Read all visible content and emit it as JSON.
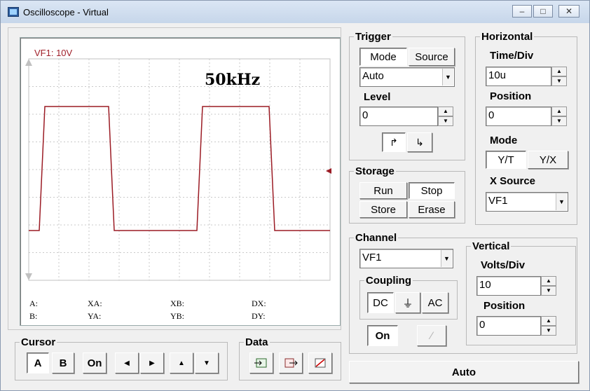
{
  "window": {
    "title": "Oscilloscope - Virtual"
  },
  "screen": {
    "channel_label": "VF1: 10V",
    "frequency": "50kHz",
    "trace_color": "#9b1b24",
    "square_wave": {
      "high_level": 1,
      "low_level": 0,
      "segments": [
        "low",
        "high",
        "low",
        "high",
        "low"
      ]
    },
    "cursor_readouts": {
      "a": "A:",
      "b": "B:",
      "xa": "XA:",
      "ya": "YA:",
      "xb": "XB:",
      "yb": "YB:",
      "dx": "DX:",
      "dy": "DY:"
    }
  },
  "trigger": {
    "title": "Trigger",
    "mode_button": "Mode",
    "source_button": "Source",
    "mode_value": "Auto",
    "level_label": "Level",
    "level_value": "0",
    "falling_edge_icon": "falling-edge-icon",
    "rising_edge_icon": "rising-edge-icon"
  },
  "horizontal": {
    "title": "Horizontal",
    "time_div_label": "Time/Div",
    "time_div_value": "10u",
    "position_label": "Position",
    "position_value": "0",
    "mode_label": "Mode",
    "yt_button": "Y/T",
    "yx_button": "Y/X",
    "x_source_label": "X Source",
    "x_source_value": "VF1"
  },
  "storage": {
    "title": "Storage",
    "run": "Run",
    "stop": "Stop",
    "store": "Store",
    "erase": "Erase"
  },
  "channel": {
    "title": "Channel",
    "channel_value": "VF1",
    "coupling_label": "Coupling",
    "dc": "DC",
    "gnd_icon": "ground-icon",
    "ac": "AC",
    "on_button": "On",
    "probe_icon": "probe-icon"
  },
  "vertical": {
    "title": "Vertical",
    "volts_div_label": "Volts/Div",
    "volts_div_value": "10",
    "position_label": "Position",
    "position_value": "0"
  },
  "cursor": {
    "title": "Cursor",
    "a": "A",
    "b": "B",
    "on": "On"
  },
  "data_group": {
    "title": "Data"
  },
  "auto_button": "Auto"
}
